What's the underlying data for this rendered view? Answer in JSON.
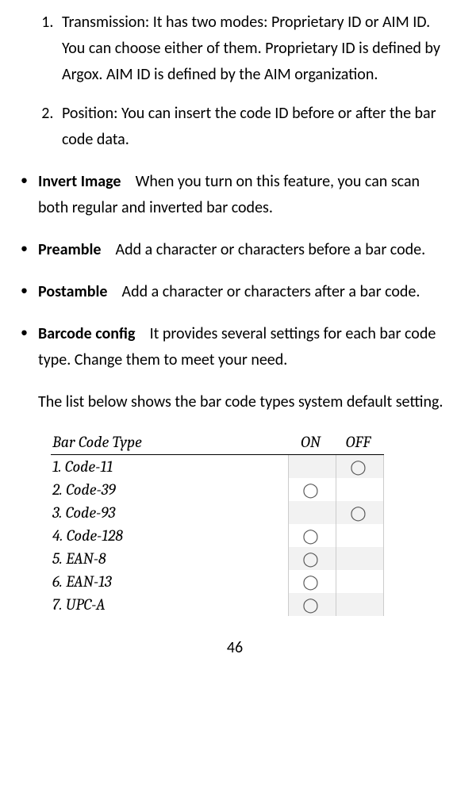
{
  "numbered": [
    "Transmission: It has two modes: Proprietary ID or AIM ID. You can choose either of them. Proprietary ID is defined by Argox. AIM ID is defined by the AIM organization.",
    "Position: You can insert the code ID before or after the bar code data."
  ],
  "bullets": [
    {
      "term": "Invert Image",
      "desc": "When you turn on this feature, you can scan both regular and inverted bar codes."
    },
    {
      "term": "Preamble",
      "desc": "Add a character or characters before a bar code."
    },
    {
      "term": "Postamble",
      "desc": "Add a character or characters after a bar code."
    },
    {
      "term": "Barcode config",
      "desc": "It provides several settings for each bar code type. Change them to meet your need."
    }
  ],
  "table_intro": "The list below shows the bar code types system default setting.",
  "table": {
    "h_type": "Bar Code Type",
    "h_on": "ON",
    "h_off": "OFF",
    "rows": [
      {
        "label": "1. Code-11",
        "on": false,
        "off": true,
        "shaded": true
      },
      {
        "label": "2. Code-39",
        "on": true,
        "off": false,
        "shaded": false
      },
      {
        "label": "3. Code-93",
        "on": false,
        "off": true,
        "shaded": true
      },
      {
        "label": "4. Code-128",
        "on": true,
        "off": false,
        "shaded": false
      },
      {
        "label": "5. EAN-8",
        "on": true,
        "off": false,
        "shaded": true
      },
      {
        "label": "6. EAN-13",
        "on": true,
        "off": false,
        "shaded": false
      },
      {
        "label": "7. UPC-A",
        "on": true,
        "off": false,
        "shaded": true
      }
    ]
  },
  "circle_glyph": "◯",
  "page_number": "46"
}
